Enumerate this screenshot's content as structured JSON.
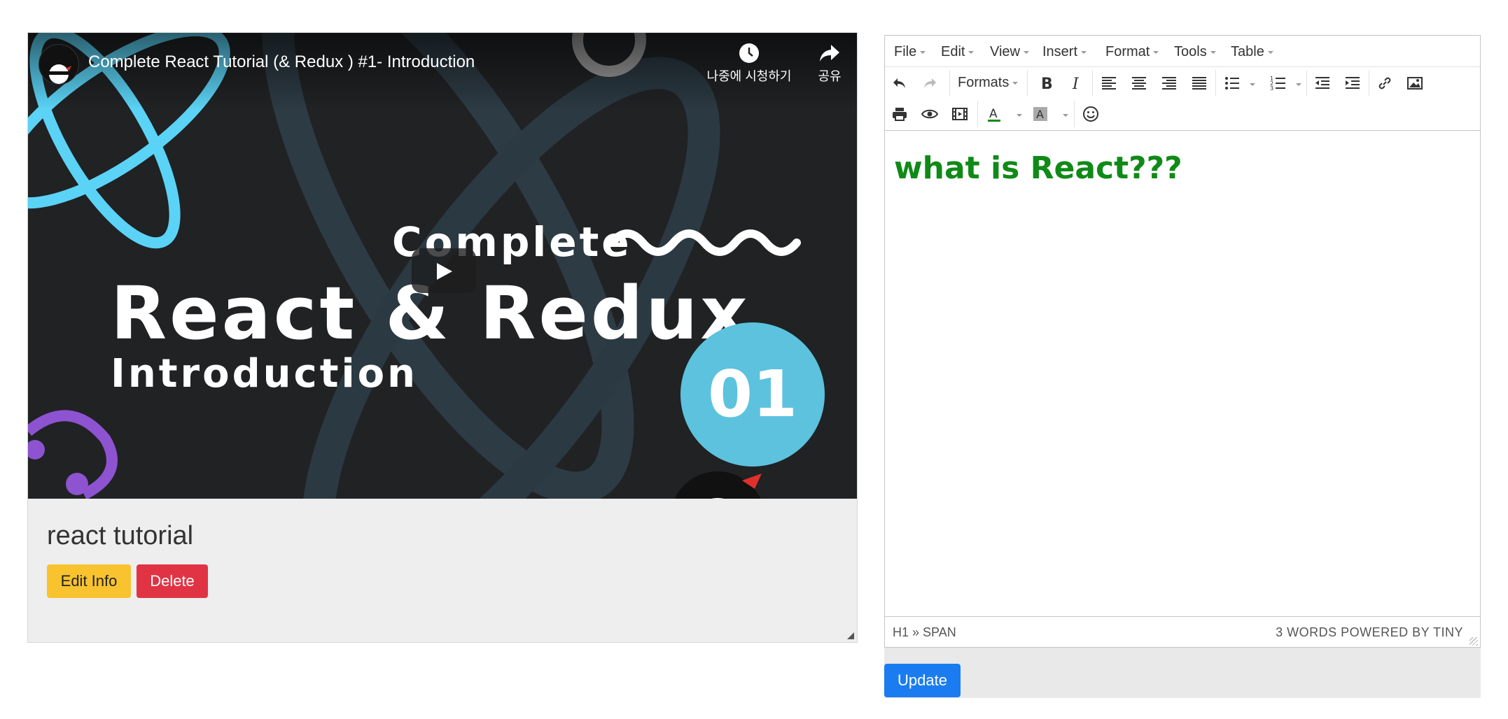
{
  "video": {
    "title": "Complete React Tutorial (& Redux ) #1- Introduction",
    "watch_later_label": "나중에 시청하기",
    "share_label": "공유",
    "thumbnail": {
      "line1": "Complete",
      "line2": "React & Redux",
      "line3": "Introduction",
      "number": "01"
    },
    "icons": [
      "channel-avatar",
      "clock-icon",
      "share-icon",
      "play-icon"
    ]
  },
  "card": {
    "title": "react tutorial",
    "edit_label": "Edit Info",
    "delete_label": "Delete",
    "colors": {
      "edit": "#f8c32e",
      "delete": "#e03444"
    }
  },
  "editor": {
    "menu": [
      "File",
      "Edit",
      "View",
      "Insert",
      "Format",
      "Tools",
      "Table"
    ],
    "formats_label": "Formats",
    "toolbar_icons": [
      "undo-icon",
      "redo-icon",
      "bold-icon",
      "italic-icon",
      "align-left-icon",
      "align-center-icon",
      "align-right-icon",
      "align-justify-icon",
      "bullet-list-icon",
      "numbered-list-icon",
      "outdent-icon",
      "indent-icon",
      "link-icon",
      "image-icon",
      "print-icon",
      "preview-icon",
      "media-icon",
      "text-color-icon",
      "background-color-icon",
      "emoticons-icon"
    ],
    "content_heading": "what is React???",
    "content_color": "#108a17",
    "status_path": "H1 » SPAN",
    "status_right": "3 WORDS POWERED BY TINY"
  },
  "update_label": "Update",
  "update_color": "#1a7cf0"
}
